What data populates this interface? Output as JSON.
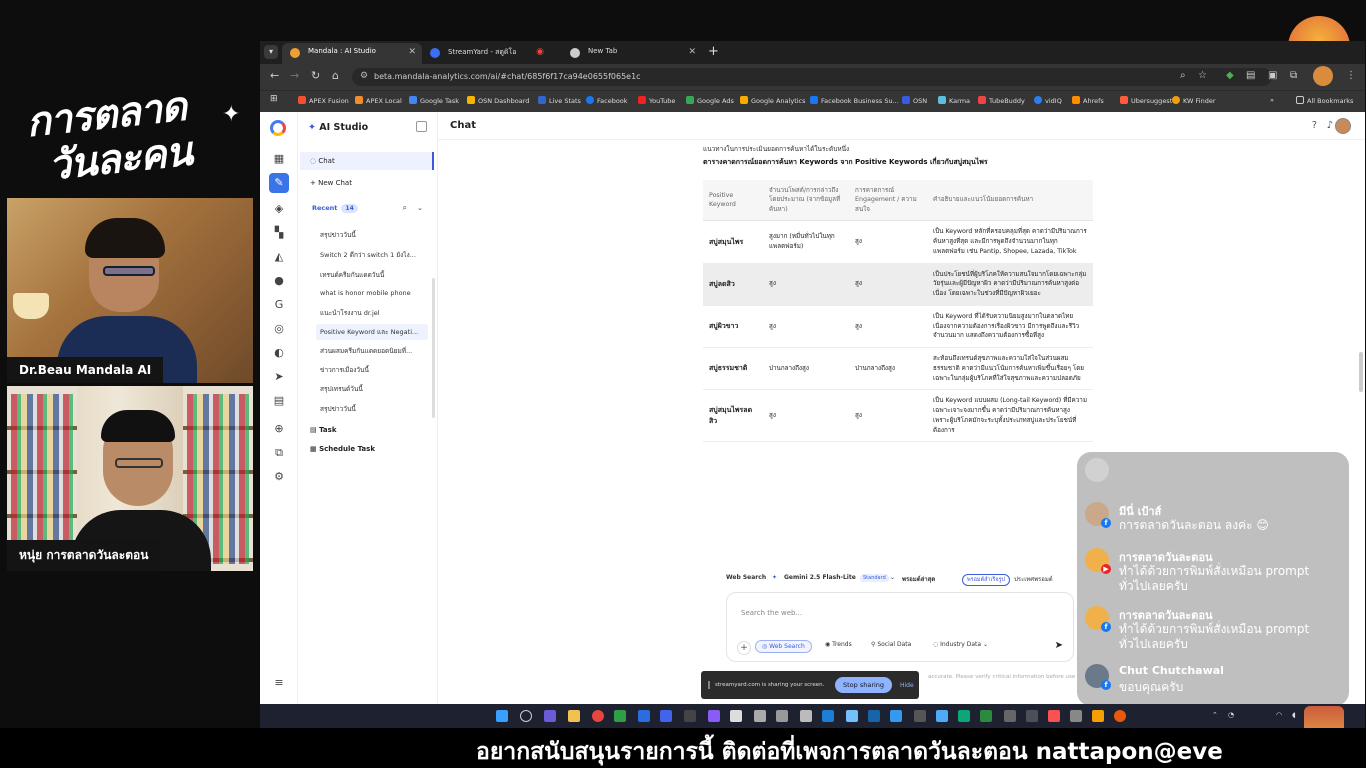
{
  "show": {
    "logo_line1": "การตลาด",
    "logo_line2": "วันละคน",
    "cam1_label": "Dr.Beau Mandala AI",
    "cam2_label": "หนุ่ย การตลาดวันละตอน",
    "ticker": "อยากสนับสนุนรายการนี้ ติดต่อที่เพจการตลาดวันละตอน nattapon@eve"
  },
  "browser": {
    "tabs": [
      {
        "label": "Mandala : AI Studio",
        "active": true
      },
      {
        "label": "StreamYard - สตูดิโอ",
        "active": false
      },
      {
        "label": "New Tab",
        "active": false
      }
    ],
    "url": "beta.mandala-analytics.com/ai/#chat/685f6f17ca94e0655f065e1c",
    "bookmarks": [
      "APEX Fusion",
      "APEX Local",
      "Google Task",
      "OSN Dashboard",
      "Live Stats",
      "Facebook",
      "YouTube",
      "Google Ads",
      "Google Analytics",
      "Facebook Business Su...",
      "OSN",
      "Karma",
      "TubeBuddy",
      "vidIQ",
      "Ahrefs",
      "Ubersuggest",
      "KW Finder"
    ],
    "all_bookmarks": "All Bookmarks"
  },
  "app": {
    "sidebar_title": "AI Studio",
    "nav_chat": "Chat",
    "new_chat": "+ New Chat",
    "recent_label": "Recent",
    "recent_count": "14",
    "history": [
      "สรุปข่าววันนี้",
      "Switch 2 ดีกว่า switch 1 ยังไง...",
      "เทรนด์ครีมกันแดดวันนี้",
      "what is honor mobile phone",
      "แนะนำโรงงาน dr.jel",
      "Positive Keyword และ Negati...",
      "ส่วนผสมครีมกันแดดยอดนิยมที่...",
      "ข่าวการเมืองวันนี้",
      "สรุปเทรนด์วันนี้",
      "สรุปข่าววันนี้"
    ],
    "task": "Task",
    "schedule_task": "Schedule Task",
    "main_title": "Chat"
  },
  "chat": {
    "intro": "แนวทางในการประเมินยอดการค้นหาได้ในระดับหนึ่ง",
    "table_title": "ตารางคาดการณ์ยอดการค้นหา Keywords จาก Positive Keywords เกี่ยวกับสบู่สมุนไพร",
    "headers": [
      "Positive Keyword",
      "จำนวนโพสต์/การกล่าวถึงโดยประมาณ (จากข้อมูลที่ค้นหา)",
      "การคาดการณ์ Engagement / ความสนใจ",
      "คำอธิบายและแนวโน้มยอดการค้นหา"
    ],
    "rows": [
      [
        "สบู่สมุนไพร",
        "สูงมาก (หมื่นทั่วไปในทุกแพลตฟอร์ม)",
        "สูง",
        "เป็น Keyword หลักที่ครอบคลุมที่สุด คาดว่ามีปริมาณการค้นหาสูงที่สุด และมีการพูดถึงจำนวนมากในทุกแพลตฟอร์ม เช่น Pantip, Shopee, Lazada, TikTok"
      ],
      [
        "สบู่ลดสิว",
        "สูง",
        "สูง",
        "เป็นประโยชน์ที่ผู้บริโภคให้ความสนใจมากโดยเฉพาะกลุ่มวัยรุ่นและผู้มีปัญหาผิว คาดว่ามีปริมาณการค้นหาสูงต่อเนื่อง โดยเฉพาะในช่วงที่มีปัญหาผิวเยอะ"
      ],
      [
        "สบู่ผิวขาว",
        "สูง",
        "สูง",
        "เป็น Keyword ที่ได้รับความนิยมสูงมากในตลาดไทย เนื่องจากความต้องการเรื่องผิวขาว มีการพูดถึงและรีวิวจำนวนมาก แสดงถึงความต้องการซื้อที่สูง"
      ],
      [
        "สบู่ธรรมชาติ",
        "ปานกลางถึงสูง",
        "ปานกลางถึงสูง",
        "สะท้อนถึงเทรนด์สุขภาพและความใส่ใจในส่วนผสมธรรมชาติ คาดว่ามีแนวโน้มการค้นหาเพิ่มขึ้นเรื่อยๆ โดยเฉพาะในกลุ่มผู้บริโภคที่ใส่ใจสุขภาพและความปลอดภัย"
      ],
      [
        "สบู่สมุนไพรลดสิว",
        "สูง",
        "สูง",
        "เป็น Keyword แบบผสม (Long-tail Keyword) ที่มีความเฉพาะเจาะจงมากขึ้น คาดว่ามีปริมาณการค้นหาสูง เพราะผู้บริโภคมักจะระบุทั้งประเภทสบู่และประโยชน์ที่ต้องการ"
      ]
    ],
    "highlight_row": 1
  },
  "composer": {
    "web_search": "Web Search",
    "model": "Gemini 2.5 Flash-Lite",
    "model_tag": "Standard",
    "mode": "พรอมต์ล่าสุด",
    "lang": "พรอมต์สำเร็จรูป",
    "country": "ประเทศพรอมต์",
    "placeholder": "Search the web...",
    "btn_web_search": "Web Search",
    "btn_trends": "Trends",
    "btn_social": "Social Data",
    "btn_industry": "Industry Data",
    "disclaimer": "accurate. Please verify critical information before use"
  },
  "share": {
    "text": "streamyard.com is sharing your screen.",
    "stop": "Stop sharing",
    "hide": "Hide"
  },
  "comments": [
    {
      "name": "มีนี่ เป้าส์",
      "text": "การตลาดวันละตอน ลงค่ะ 😊",
      "platform": "facebook"
    },
    {
      "name": "การตลาดวันละตอน",
      "text": "ทำได้ด้วยการพิมพ์สั่งเหมือน prompt ทั่วไปเลยครับ",
      "platform": "youtube"
    },
    {
      "name": "การตลาดวันละตอน",
      "text": "ทำได้ด้วยการพิมพ์สั่งเหมือน prompt ทั่วไปเลยครับ",
      "platform": "facebook"
    },
    {
      "name": "Chut Chutchawal",
      "text": "ขอบคุณครับ",
      "platform": "facebook"
    }
  ],
  "colors": {
    "accent": "#3b5bdb",
    "facebook": "#1877f2",
    "youtube": "#e22222"
  }
}
